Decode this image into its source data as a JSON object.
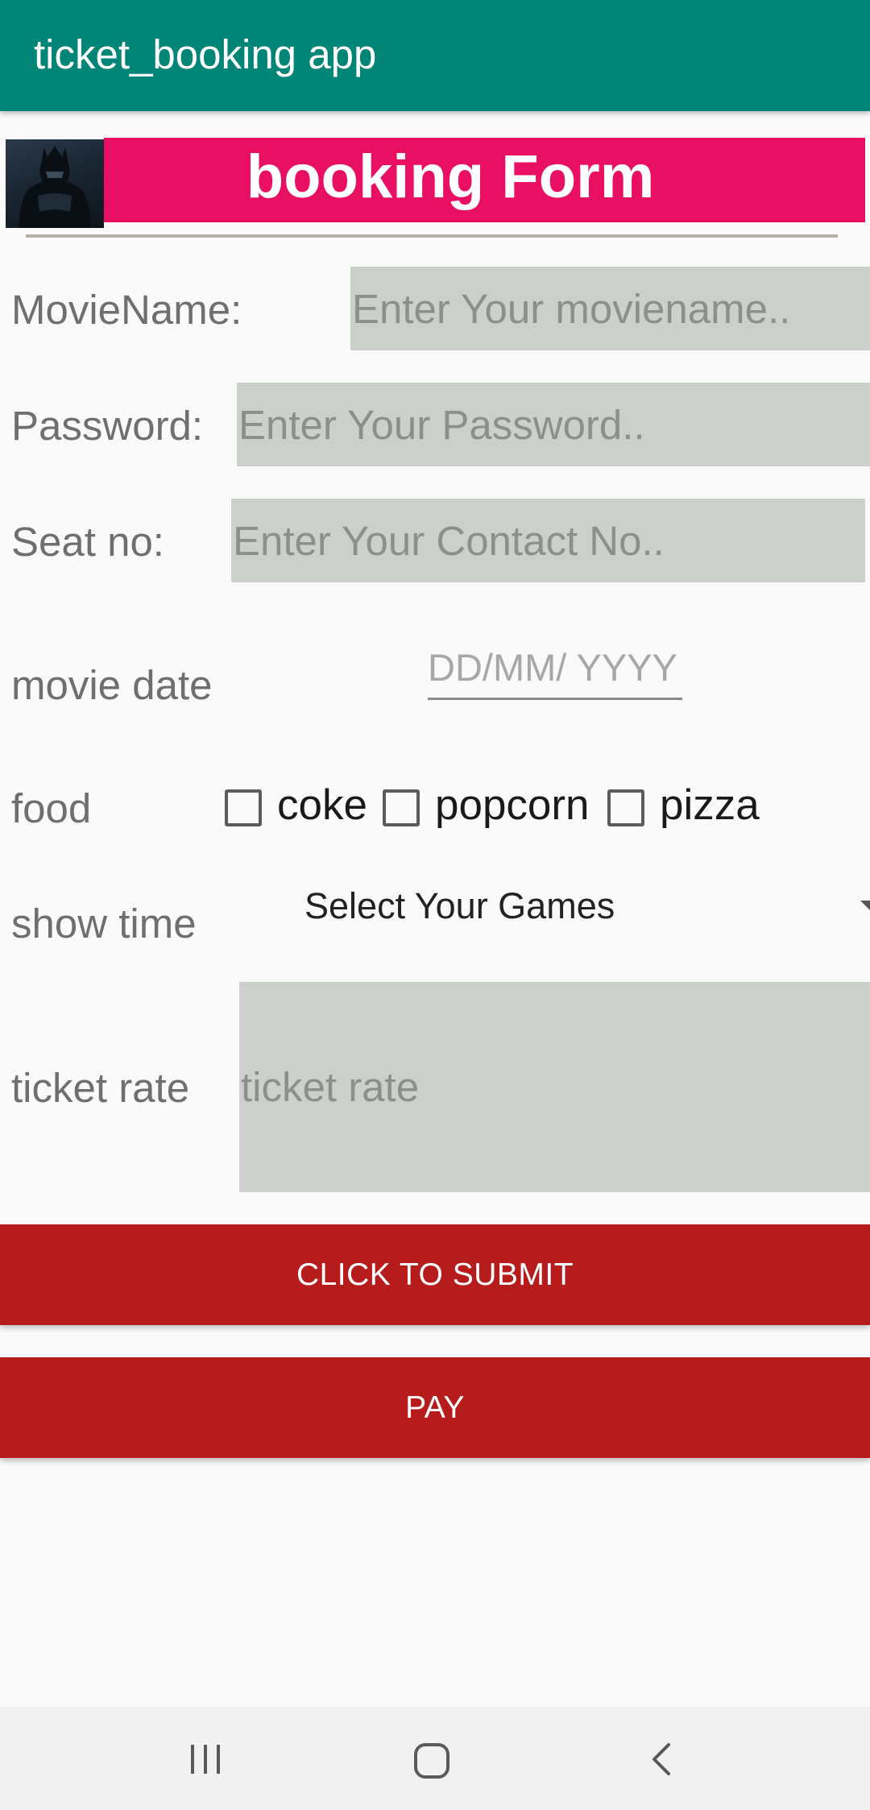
{
  "app_bar": {
    "title": "ticket_booking app"
  },
  "header": {
    "title": "booking Form"
  },
  "form": {
    "moviename": {
      "label": "MovieName:",
      "placeholder": "Enter Your moviename.."
    },
    "password": {
      "label": "Password:",
      "placeholder": "Enter Your Password.."
    },
    "seat": {
      "label": "Seat no:",
      "placeholder": "Enter Your Contact No.."
    },
    "date": {
      "label": "movie date",
      "placeholder": "DD/MM/ YYYY"
    },
    "food": {
      "label": "food",
      "options": [
        {
          "label": "coke",
          "checked": false
        },
        {
          "label": "popcorn",
          "checked": false
        },
        {
          "label": "pizza",
          "checked": false
        }
      ]
    },
    "showtime": {
      "label": "show time",
      "selected": "Select Your Games"
    },
    "rate": {
      "label": "ticket rate",
      "placeholder": "ticket rate"
    }
  },
  "buttons": {
    "submit": "CLICK TO SUBMIT",
    "pay": "PAY"
  },
  "nav": {
    "icons": [
      "recent-apps-icon",
      "home-icon",
      "back-icon"
    ]
  },
  "colors": {
    "app_bar": "#008577",
    "header_band": "#e91063",
    "field_bg": "#cbd1ca",
    "button": "#b71c1c"
  }
}
